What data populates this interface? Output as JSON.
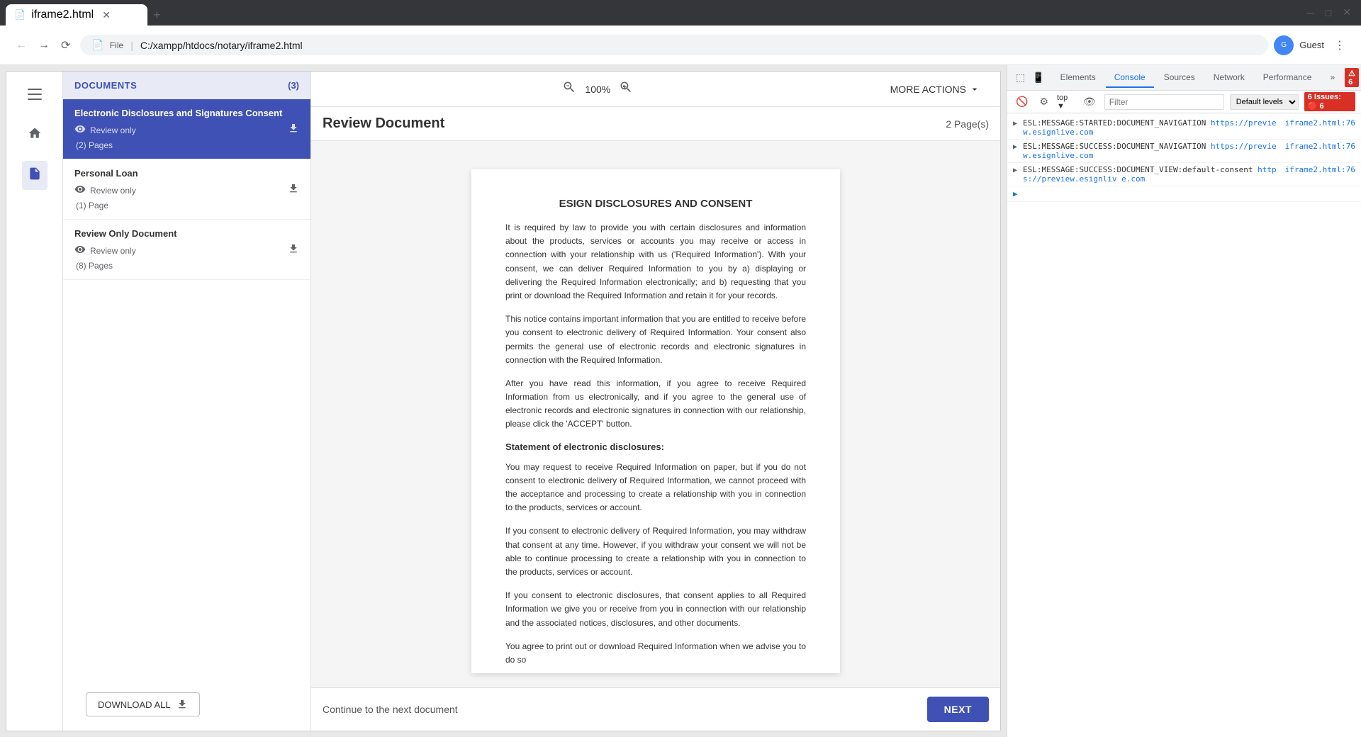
{
  "browser": {
    "tab_title": "iframe2.html",
    "tab_favicon": "📄",
    "url": "C:/xampp/htdocs/notary/iframe2.html",
    "url_icon": "📄"
  },
  "devtools": {
    "tabs": [
      "Elements",
      "Console",
      "Sources",
      "Network",
      "Performance"
    ],
    "active_tab": "Console",
    "error_count": "6",
    "filter_placeholder": "Filter",
    "levels_label": "Default levels",
    "console_entries": [
      {
        "text": "ESL:MESSAGE:STARTED:DOCUMENT_NAVIGATION",
        "link": "https://preview.esignlive.com",
        "file": "iframe2.html:76"
      },
      {
        "text": "ESL:MESSAGE:SUCCESS:DOCUMENT_NAVIGATION",
        "link": "https://preview.esignlive.com",
        "file": "iframe2.html:76"
      },
      {
        "text": "ESL:MESSAGE:SUCCESS:DOCUMENT_VIEW:default-consent",
        "link": "https://preview.esignliv e.com",
        "file": "iframe2.html:76"
      }
    ]
  },
  "notary": {
    "toolbar": {
      "zoom_level": "100%",
      "more_actions_label": "MORE ACTIONS"
    },
    "sidebar": {
      "documents_label": "DOCUMENTS",
      "documents_count": "(3)",
      "items": [
        {
          "title": "Electronic Disclosures and Signatures Consent",
          "review_label": "Review only",
          "pages": "(2) Pages",
          "active": true
        },
        {
          "title": "Personal Loan",
          "review_label": "Review only",
          "pages": "(1) Page",
          "active": false
        },
        {
          "title": "Review Only Document",
          "review_label": "Review only",
          "pages": "(8) Pages",
          "active": false
        }
      ],
      "download_all_label": "DOWNLOAD ALL"
    },
    "document": {
      "title": "Review Document",
      "pages_count": "2 Page(s)",
      "main_title": "ESIGN DISCLOSURES AND CONSENT",
      "paragraphs": [
        "It is required by law to provide you with certain disclosures and information about the products, services or accounts you may receive or access in connection with your relationship with us ('Required Information'). With your consent, we can deliver Required Information to you by a) displaying or delivering the Required Information electronically; and b) requesting that you print or download the Required Information and retain it for your records.",
        "This notice contains important information that you are entitled to receive before you consent to electronic delivery of Required Information. Your consent also permits the general use of electronic records and electronic signatures in connection with the Required Information.",
        "After you have read this information, if you agree to receive Required Information from us electronically, and if you agree to the general use of electronic records and electronic signatures in connection with our relationship, please click the 'ACCEPT' button.",
        "You may request to receive Required Information on paper, but if you do not consent to electronic delivery of Required Information, we cannot proceed with the acceptance and processing to create a relationship with you in connection to the products, services or account.",
        "If you consent to electronic delivery of Required Information, you may withdraw that consent at any time. However, if you withdraw your consent we will not be able to continue processing to create a relationship with you in connection to the products, services or account.",
        "If you consent to electronic disclosures, that consent applies to all Required Information we give you or receive from you in connection with our relationship and the associated notices, disclosures, and other documents.",
        "You agree to print out or download Required Information when we advise you to do so"
      ],
      "section_title": "Statement of electronic disclosures:",
      "footer_text": "Continue to the next document",
      "next_button_label": "NEXT"
    }
  }
}
